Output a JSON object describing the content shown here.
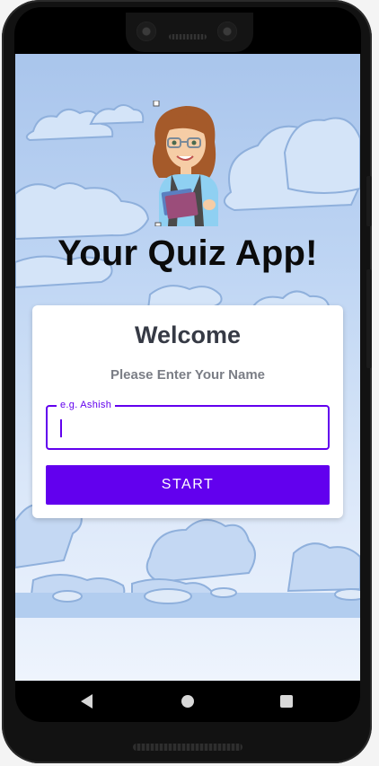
{
  "app": {
    "title": "Your Quiz App!"
  },
  "card": {
    "heading": "Welcome",
    "subtitle": "Please Enter Your Name",
    "name_field": {
      "label": "e.g. Ashish",
      "value": ""
    },
    "start_label": "START"
  },
  "colors": {
    "accent": "#6200ee",
    "title_text": "#0b0b0b",
    "card_heading": "#363a45",
    "card_subtitle": "#7b7e86",
    "sky_top": "#a9c5ec",
    "sky_bottom": "#eef4fd"
  },
  "icons": {
    "nav_back": "back-triangle-icon",
    "nav_home": "home-circle-icon",
    "nav_recent": "recents-square-icon"
  }
}
